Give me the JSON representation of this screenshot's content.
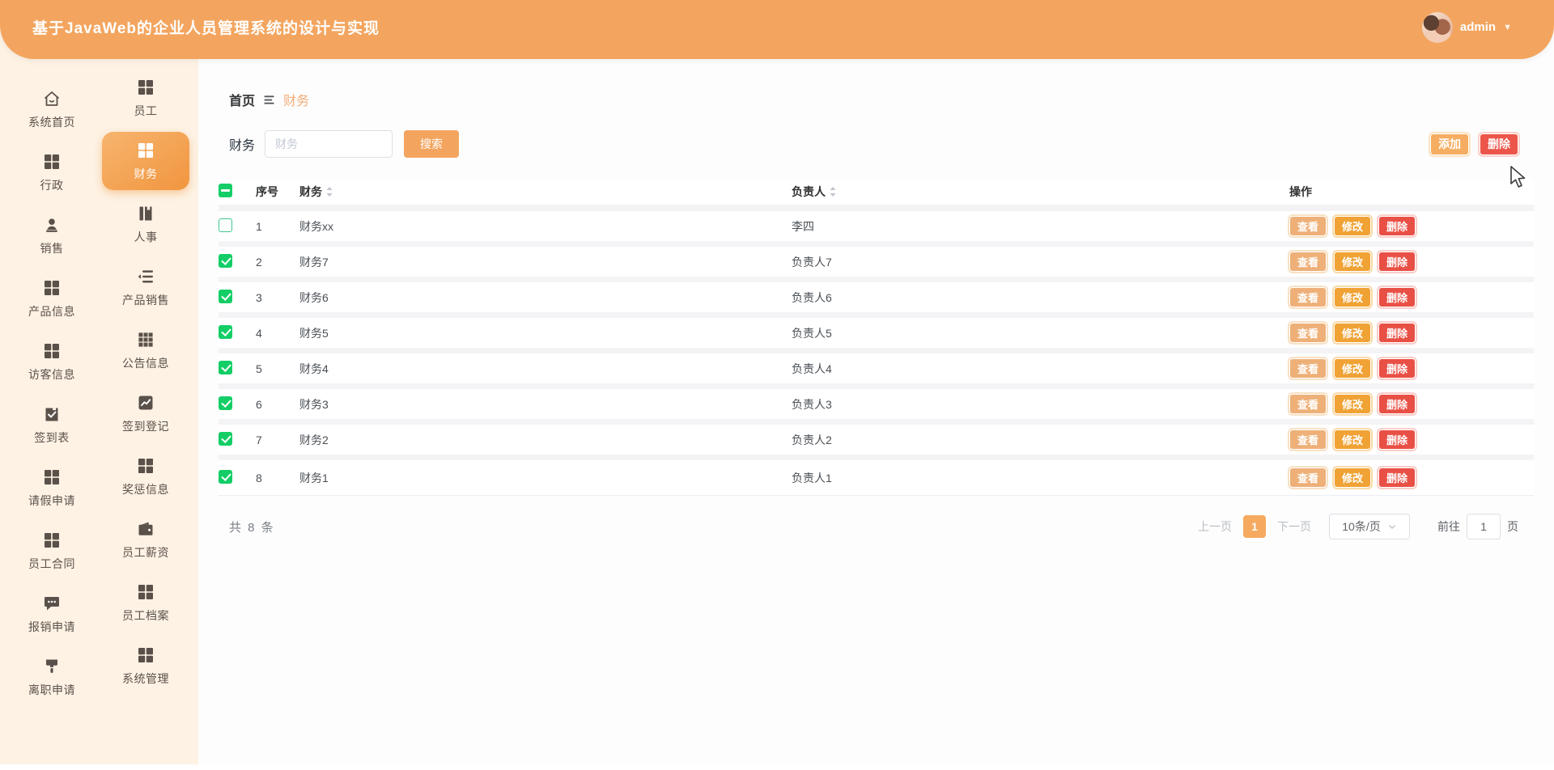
{
  "header": {
    "title": "基于JavaWeb的企业人员管理系统的设计与实现",
    "username": "admin"
  },
  "sidebar": {
    "items": [
      {
        "label": "系统首页",
        "icon": "home",
        "active": false
      },
      {
        "label": "员工",
        "icon": "grid",
        "active": false
      },
      {
        "label": "行政",
        "icon": "grid",
        "active": false
      },
      {
        "label": "财务",
        "icon": "grid",
        "active": true
      },
      {
        "label": "销售",
        "icon": "user",
        "active": false
      },
      {
        "label": "人事",
        "icon": "notebook",
        "active": false
      },
      {
        "label": "产品信息",
        "icon": "grid",
        "active": false
      },
      {
        "label": "产品销售",
        "icon": "list",
        "active": false
      },
      {
        "label": "访客信息",
        "icon": "grid",
        "active": false
      },
      {
        "label": "公告信息",
        "icon": "grid-dense",
        "active": false
      },
      {
        "label": "签到表",
        "icon": "clipboard-check",
        "active": false
      },
      {
        "label": "签到登记",
        "icon": "trend-chart",
        "active": false
      },
      {
        "label": "请假申请",
        "icon": "grid",
        "active": false
      },
      {
        "label": "奖惩信息",
        "icon": "grid",
        "active": false
      },
      {
        "label": "员工合同",
        "icon": "grid",
        "active": false
      },
      {
        "label": "员工薪资",
        "icon": "wallet",
        "active": false
      },
      {
        "label": "报销申请",
        "icon": "comment",
        "active": false
      },
      {
        "label": "员工档案",
        "icon": "grid",
        "active": false
      },
      {
        "label": "离职申请",
        "icon": "brush",
        "active": false
      },
      {
        "label": "系统管理",
        "icon": "grid",
        "active": false
      }
    ]
  },
  "breadcrumb": {
    "home": "首页",
    "current": "财务"
  },
  "search": {
    "label": "财务",
    "placeholder": "财务",
    "button": "搜索"
  },
  "toolbar": {
    "add": "添加",
    "delete": "删除"
  },
  "table": {
    "select_all_state": "indeterminate",
    "headers": {
      "index": "序号",
      "name": "财务",
      "owner": "负责人",
      "actions": "操作"
    },
    "actions": {
      "view": "查看",
      "edit": "修改",
      "delete": "删除"
    },
    "rows": [
      {
        "index": 1,
        "name": "财务xx",
        "owner": "李四",
        "checked": false
      },
      {
        "index": 2,
        "name": "财务7",
        "owner": "负责人7",
        "checked": true
      },
      {
        "index": 3,
        "name": "财务6",
        "owner": "负责人6",
        "checked": true
      },
      {
        "index": 4,
        "name": "财务5",
        "owner": "负责人5",
        "checked": true
      },
      {
        "index": 5,
        "name": "财务4",
        "owner": "负责人4",
        "checked": true
      },
      {
        "index": 6,
        "name": "财务3",
        "owner": "负责人3",
        "checked": true
      },
      {
        "index": 7,
        "name": "财务2",
        "owner": "负责人2",
        "checked": true
      },
      {
        "index": 8,
        "name": "财务1",
        "owner": "负责人1",
        "checked": true
      }
    ]
  },
  "pagination": {
    "total": "共 8 条",
    "prev": "上一页",
    "current_page": "1",
    "next": "下一页",
    "page_size": "10条/页",
    "goto_label": "前往",
    "goto_value": "1",
    "goto_suffix": "页"
  },
  "colors": {
    "accent": "#f3a55f",
    "danger": "#ec5549",
    "warning": "#f0a234",
    "success": "#13ce66",
    "sidebar_bg": "#fdf2e4"
  }
}
